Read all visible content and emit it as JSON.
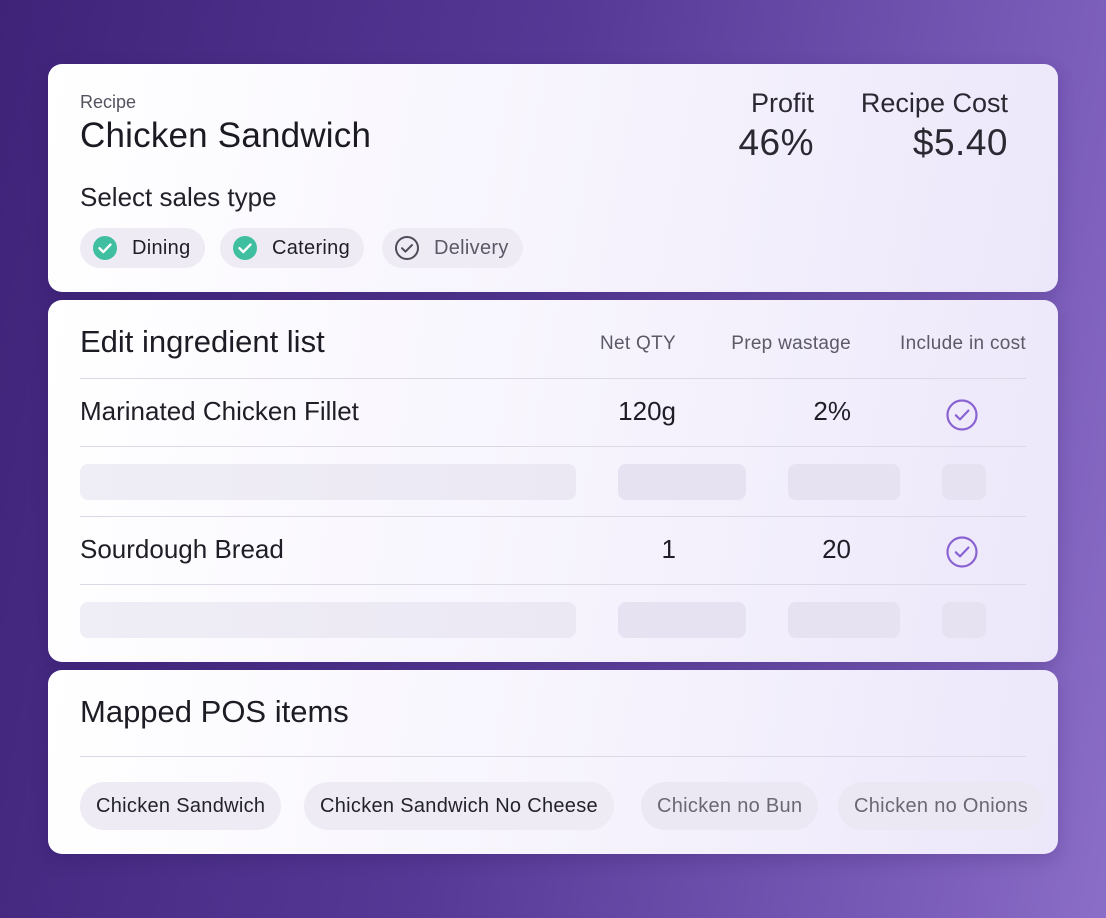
{
  "recipe": {
    "label": "Recipe",
    "name": "Chicken Sandwich",
    "sales_type_label": "Select sales type",
    "sales_types": [
      {
        "label": "Dining",
        "selected": true
      },
      {
        "label": "Catering",
        "selected": true
      },
      {
        "label": "Delivery",
        "selected": false
      }
    ],
    "profit_label": "Profit",
    "profit_value": "46%",
    "cost_label": "Recipe Cost",
    "cost_value": "$5.40"
  },
  "ingredients": {
    "title": "Edit ingredient list",
    "columns": [
      "Net QTY",
      "Prep wastage",
      "Include in cost"
    ],
    "rows": [
      {
        "name": "Marinated Chicken Fillet",
        "qty": "120g",
        "wastage": "2%",
        "included": true
      },
      {
        "name": "Sourdough Bread",
        "qty": "1",
        "wastage": "20",
        "included": true
      }
    ]
  },
  "pos": {
    "title": "Mapped POS items",
    "items": [
      {
        "label": "Chicken Sandwich",
        "active": true
      },
      {
        "label": "Chicken Sandwich No Cheese",
        "active": true
      },
      {
        "label": "Chicken no Bun",
        "active": false
      },
      {
        "label": "Chicken no Onions",
        "active": false
      }
    ]
  },
  "colors": {
    "accent_green": "#3fbf9f",
    "accent_purple": "#8a63d2",
    "background": "#553895"
  }
}
